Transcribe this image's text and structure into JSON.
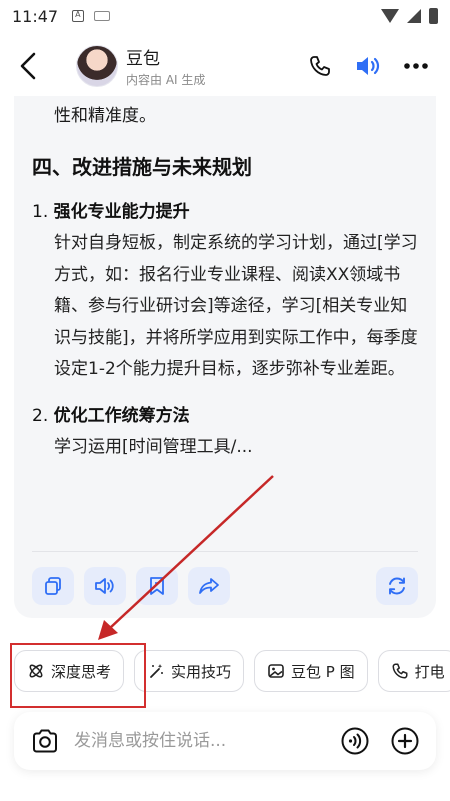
{
  "status": {
    "time": "11:47"
  },
  "header": {
    "bot_name": "豆包",
    "bot_subtitle": "内容由 AI 生成"
  },
  "message": {
    "intro_tail": "性和精准度。",
    "section_heading": "四、改进措施与未来规划",
    "items": [
      {
        "number": "1.",
        "title": "强化专业能力提升",
        "body": "针对自身短板，制定系统的学习计划，通过[学习方式，如：报名行业专业课程、阅读XX领域书籍、参与行业研讨会]等途径，学习[相关专业知识与技能]，并将所学应用到实际工作中，每季度设定1-2个能力提升目标，逐步弥补专业差距。"
      },
      {
        "number": "2.",
        "title": "优化工作统筹方法",
        "body": "学习运用[时间管理工具/..."
      }
    ]
  },
  "quick_chips": [
    {
      "label": "深度思考",
      "icon": "atom-icon"
    },
    {
      "label": "实用技巧",
      "icon": "magic-wand-icon"
    },
    {
      "label": "豆包 P 图",
      "icon": "image-icon"
    },
    {
      "label": "打电",
      "icon": "phone-icon"
    }
  ],
  "input": {
    "placeholder": "发消息或按住说话..."
  },
  "colors": {
    "accent": "#2f6ef5",
    "action_bg": "#e6ecfb",
    "card_bg": "#f5f6f8",
    "annotation_red": "#d32f2f"
  }
}
